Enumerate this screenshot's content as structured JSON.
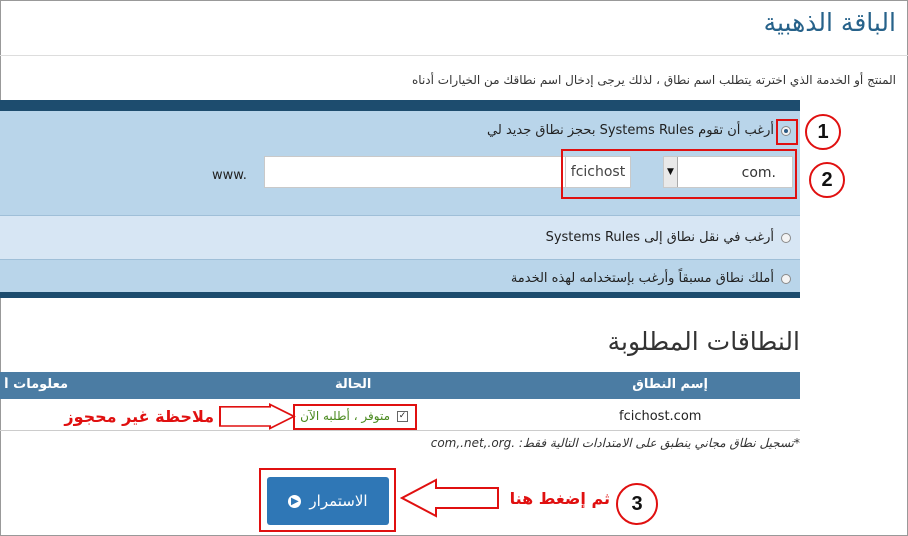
{
  "page": {
    "title": "الباقة الذهبية",
    "intro": "المنتج أو الخدمة الذي اخترته يتطلب اسم نطاق ، لذلك يرجى إدخال اسم نطاقك من الخيارات أدناه"
  },
  "domain_options": {
    "register": {
      "label": "أرغب أن تقوم Systems Rules بحجز نطاق جديد لي",
      "selected": true
    },
    "www_prefix": "www.",
    "domain_value": "fcichost",
    "tld_value": "com.",
    "transfer": {
      "label": "أرغب في نقل نطاق إلى Systems Rules"
    },
    "own": {
      "label": "أملك نطاق مسبقاً وأرغب بإستخدامه لهذه الخدمة"
    }
  },
  "domains_table": {
    "title": "النطاقات المطلوبة",
    "headers": {
      "domain": "إسم النطاق",
      "status": "الحالة",
      "info": "معلومات أ"
    },
    "rows": [
      {
        "domain": "fcichost.com",
        "status": "متوفر ، أطلبه الآن"
      }
    ],
    "footnote": "*تسجيل نطاق مجاني ينطبق على الامتدادات التالية فقط: .com,.net,.org"
  },
  "continue_button": {
    "label": "الاستمرار"
  },
  "annotations": {
    "step1": "1",
    "step2": "2",
    "step3": "3",
    "note_available": "ملاحظة غير محجوز",
    "note_click": "ثم إضغط هنا"
  },
  "colors": {
    "accent": "#27628a",
    "panel": "#b9d5ea",
    "panel_dark": "#1d4c6e",
    "table_header": "#4b7ca3",
    "button": "#2f77b6",
    "annotation_red": "#e01010",
    "available_green": "#4a8a1f"
  }
}
